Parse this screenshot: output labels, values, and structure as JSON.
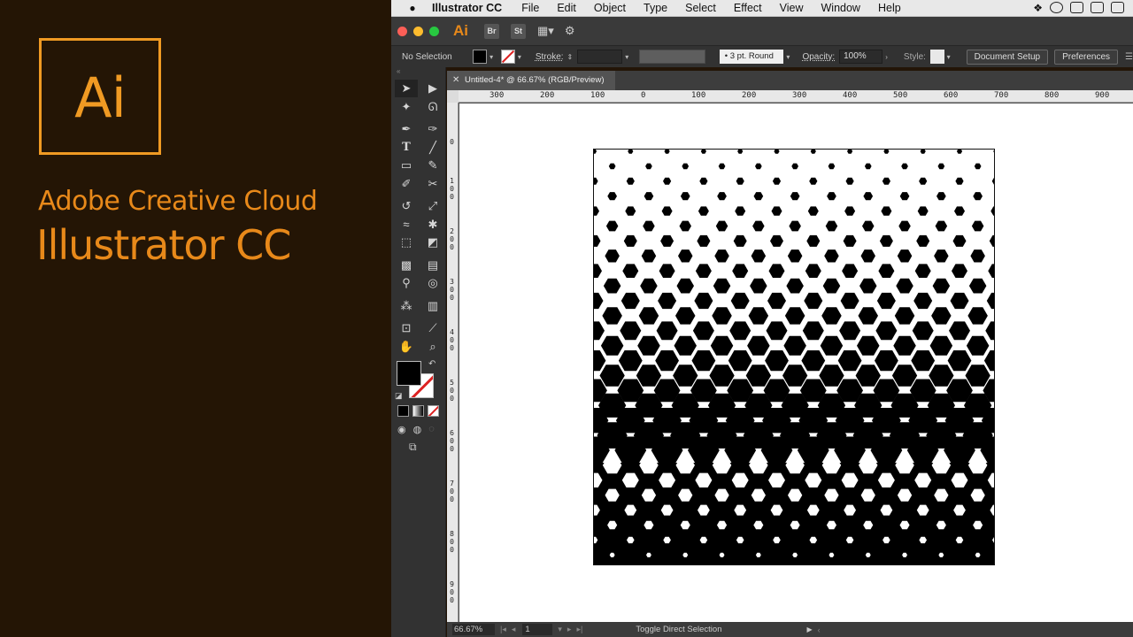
{
  "brand": {
    "logo_text": "Ai",
    "line1": "Adobe Creative Cloud",
    "line2": "Illustrator CC"
  },
  "menubar": {
    "app_name": "Illustrator CC",
    "items": [
      "File",
      "Edit",
      "Object",
      "Type",
      "Select",
      "Effect",
      "View",
      "Window",
      "Help"
    ]
  },
  "appbar": {
    "ai_label": "Ai",
    "bridge": "Br",
    "stock": "St"
  },
  "controlbar": {
    "selection": "No Selection",
    "stroke_label": "Stroke:",
    "brush": "3 pt. Round",
    "opacity_label": "Opacity:",
    "opacity_value": "100%",
    "style_label": "Style:",
    "document_setup": "Document Setup",
    "preferences": "Preferences"
  },
  "document": {
    "tab_title": "Untitled-4* @ 66.67% (RGB/Preview)"
  },
  "rulers": {
    "horizontal": [
      "300",
      "200",
      "100",
      "0",
      "100",
      "200",
      "300",
      "400",
      "500",
      "600",
      "700",
      "800",
      "900"
    ],
    "vertical": [
      "0",
      "100",
      "200",
      "300",
      "400",
      "500",
      "600",
      "700",
      "800",
      "900"
    ]
  },
  "statusbar": {
    "zoom": "66.67%",
    "page": "1",
    "status": "Toggle Direct Selection"
  },
  "colors": {
    "brand_orange": "#e8891a",
    "fill": "#000000",
    "stroke_none": "#dd2222"
  }
}
